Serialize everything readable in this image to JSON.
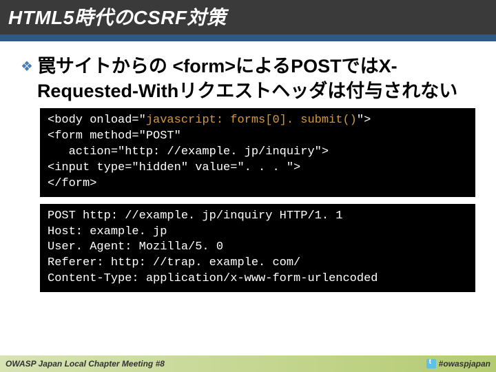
{
  "header": {
    "title": "HTML5時代のCSRF対策"
  },
  "bullet": {
    "text": "罠サイトからの <form>によるPOSTではX-Requested-Withリクエストヘッダは付与されない"
  },
  "code1": {
    "l1a": "<body onload=\"",
    "l1b": "javascript: forms[0]. submit()",
    "l1c": "\">",
    "l2": "<form method=\"POST\"",
    "l3": "   action=\"http: //example. jp/inquiry\">",
    "l4": "<input type=\"hidden\" value=\". . . \">",
    "l5": "</form>"
  },
  "code2": {
    "l1": "POST http: //example. jp/inquiry HTTP/1. 1",
    "l2": "Host: example. jp",
    "l3": "User. Agent: Mozilla/5. 0",
    "l4": "Referer: http: //trap. example. com/",
    "l5": "Content-Type: application/x-www-form-urlencoded"
  },
  "footer": {
    "left": "OWASP Japan Local Chapter Meeting #8",
    "hashtag": "#owaspjapan"
  }
}
